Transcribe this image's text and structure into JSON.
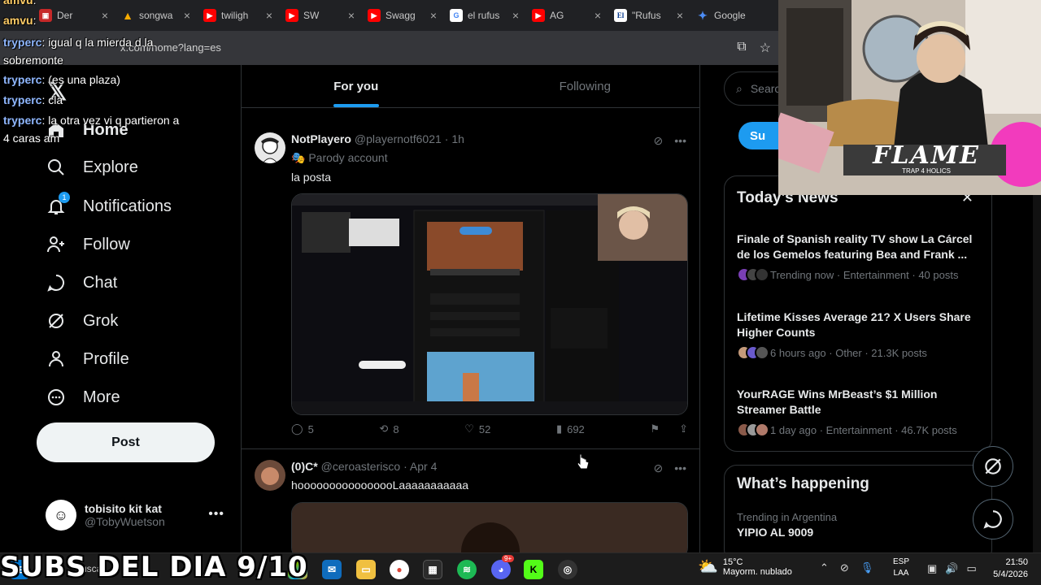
{
  "browser": {
    "tabs": [
      {
        "title": "Der",
        "favicon": "red-square-icon"
      },
      {
        "title": "songwa",
        "favicon": "drive-icon"
      },
      {
        "title": "twiligh",
        "favicon": "youtube-icon"
      },
      {
        "title": "SW",
        "favicon": "youtube-icon"
      },
      {
        "title": "Swagg",
        "favicon": "youtube-icon"
      },
      {
        "title": "el rufus",
        "favicon": "google-icon"
      },
      {
        "title": "AG",
        "favicon": "youtube-icon"
      },
      {
        "title": "\"Rufus",
        "favicon": "el-icon"
      },
      {
        "title": "Google",
        "favicon": "gemini-icon"
      }
    ],
    "url": "x.com/home?lang=es"
  },
  "chat": [
    {
      "user": "amvu",
      "text": ":"
    },
    {
      "user": "amvu",
      "text": ":"
    },
    {
      "user": "tryperc",
      "text": ": igual q la mierda d la"
    },
    {
      "user": "",
      "text": "sobremonte"
    },
    {
      "user": "tryperc",
      "text": ": (es una plaza)"
    },
    {
      "user": "tryperc",
      "text": ": cla"
    },
    {
      "user": "tryperc",
      "text": ": la otra vez vi q partieron a"
    },
    {
      "user": "",
      "text": "4 caras am"
    }
  ],
  "nav": {
    "home": "Home",
    "explore": "Explore",
    "notifications": "Notifications",
    "notif_count": "1",
    "follow": "Follow",
    "chat": "Chat",
    "grok": "Grok",
    "profile": "Profile",
    "more": "More",
    "post": "Post"
  },
  "account": {
    "name": "tobisito kit kat",
    "handle": "@TobyWuetson"
  },
  "feed": {
    "tabs": [
      "For you",
      "Following"
    ],
    "tweets": [
      {
        "name": "NotPlayero",
        "handle": "@playernotf6021",
        "time": "· 1h",
        "parody": "Parody account",
        "text": "la posta",
        "replies": "5",
        "reposts": "8",
        "likes": "52",
        "views": "692"
      },
      {
        "name": "(0)C*",
        "handle": "@ceroasterisco",
        "time": "· Apr 4",
        "text": "hoooooooooooooooLaaaaaaaaaaa"
      }
    ]
  },
  "right": {
    "search_placeholder": "Searc",
    "subscribe": "Su",
    "news_title": "Today’s News",
    "news": [
      {
        "headline": "Finale of Spanish reality TV show La Cárcel de los Gemelos featuring Bea and Frank ...",
        "meta": "Trending now · Entertainment · 40 posts"
      },
      {
        "headline": "Lifetime Kisses Average 21? X Users Share Higher Counts",
        "meta": "6 hours ago · Other · 21.3K posts"
      },
      {
        "headline": "YourRAGE Wins MrBeast’s $1 Million Streamer Battle",
        "meta": "1 day ago · Entertainment · 46.7K posts"
      }
    ],
    "happening_title": "What’s happening",
    "happening_sub": "Trending in Argentina",
    "happening_topic": "YIPIO AL 9009"
  },
  "cam": {
    "overlay_text": "FLAME",
    "overlay_sub": "TRAP 4 HOLICS"
  },
  "taskbar": {
    "search": "Buscar",
    "temp": "15°C",
    "weather": "Mayorm. nublado",
    "lang1": "ESP",
    "lang2": "LAA",
    "time": "21:50",
    "date": "5/4/2026",
    "discord_badge": "9+"
  },
  "subs_banner": "SUBS DEL DIA 9/10"
}
